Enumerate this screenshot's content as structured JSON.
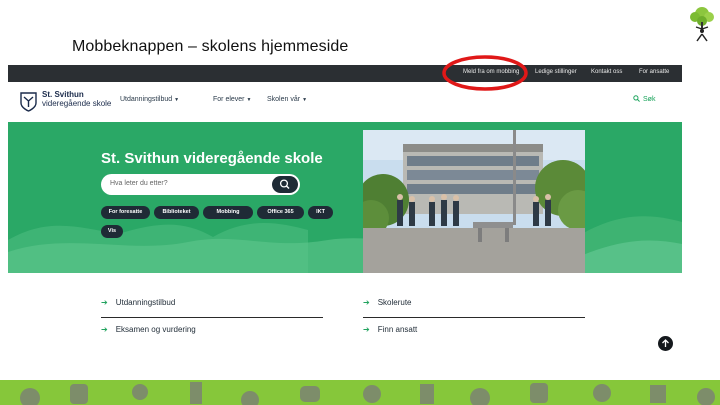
{
  "slide": {
    "title": "Mobbeknappen – skolens hjemmeside"
  },
  "topbar": {
    "links": [
      "Meld fra om mobbing",
      "Ledige stillinger",
      "Kontakt oss",
      "For ansatte"
    ]
  },
  "header": {
    "name_line1": "St. Svithun",
    "name_line2": "videregående skole",
    "nav": [
      "Utdanningstilbud",
      "For elever",
      "Skolen vår"
    ],
    "search_label": "Søk"
  },
  "hero": {
    "title": "St. Svithun videregående skole",
    "search_placeholder": "Hva leter du etter?",
    "pills": [
      "For foresatte",
      "Biblioteket",
      "Mobbing",
      "Office 365",
      "IKT",
      "Vis"
    ]
  },
  "links": {
    "left": [
      "Utdanningstilbud",
      "Eksamen og vurdering"
    ],
    "right": [
      "Skolerute",
      "Finn ansatt"
    ]
  },
  "colors": {
    "hero_green": "#2aa866",
    "topbar": "#2b2f33",
    "dark_navy": "#1f2b36",
    "highlight_red": "#e01818",
    "band_green": "#86c73a"
  },
  "icons": [
    "tree-logo-icon",
    "crest-icon",
    "search-icon",
    "arrow-right-icon",
    "arrow-up-icon"
  ]
}
